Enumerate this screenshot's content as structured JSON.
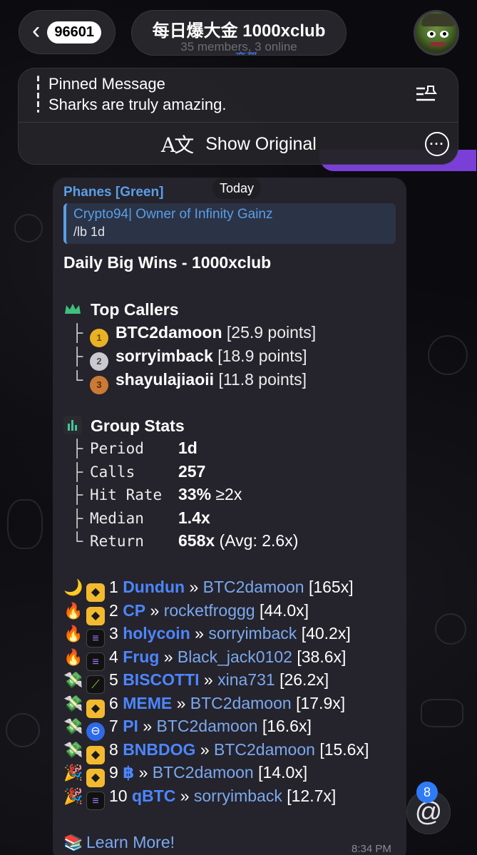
{
  "header": {
    "back_badge": "96601",
    "title": "每日爆大金 1000xclub",
    "subtitle": "35 members, 3 online",
    "typing": "••• 奕哥"
  },
  "pinned": {
    "label": "Pinned Message",
    "text": "Sharks are truly amazing.",
    "show_original": "Show Original"
  },
  "chat": {
    "date_badge": "Today",
    "sender": "Phanes [Green]",
    "reply_name": "Crypto94| Owner of Infinity Gainz",
    "reply_text": "/lb 1d",
    "headline": "Daily Big Wins - 1000xclub",
    "top_callers_title": "Top Callers",
    "top_callers": [
      {
        "tree": "├",
        "name": "BTC2damoon",
        "points": "[25.9 points]"
      },
      {
        "tree": "├",
        "name": "sorryimback",
        "points": "[18.9 points]"
      },
      {
        "tree": "└",
        "name": "shayulajiaoii",
        "points": "[11.8 points]"
      }
    ],
    "group_stats_title": "Group Stats",
    "stats": [
      {
        "tree": "├",
        "label": "Period ",
        "value": "1d",
        "extra": ""
      },
      {
        "tree": "├",
        "label": "Calls  ",
        "value": "257",
        "extra": ""
      },
      {
        "tree": "├",
        "label": "Hit Rate",
        "value": "33%",
        "extra": " ≥2x"
      },
      {
        "tree": "├",
        "label": "Median ",
        "value": "1.4x",
        "extra": ""
      },
      {
        "tree": "└",
        "label": "Return ",
        "value": "658x",
        "extra": " (Avg: 2.6x)"
      }
    ],
    "wins": [
      {
        "emoji": "🌙",
        "chain": "bnb",
        "rank": "1",
        "token": "Dundun",
        "caller": "BTC2damoon",
        "mult": "[165x]"
      },
      {
        "emoji": "🔥",
        "chain": "bnb",
        "rank": "2",
        "token": "CP",
        "caller": "rocketfroggg",
        "mult": "[44.0x]"
      },
      {
        "emoji": "🔥",
        "chain": "sol",
        "rank": "3",
        "token": "holycoin",
        "caller": "sorryimback",
        "mult": "[40.2x]"
      },
      {
        "emoji": "🔥",
        "chain": "sol",
        "rank": "4",
        "token": "Frug",
        "caller": "Black_jack0102",
        "mult": "[38.6x]"
      },
      {
        "emoji": "💸",
        "chain": "leaf",
        "rank": "5",
        "token": "BISCOTTI",
        "caller": "xina731",
        "mult": "[26.2x]"
      },
      {
        "emoji": "💸",
        "chain": "bnb",
        "rank": "6",
        "token": "MEME",
        "caller": "BTC2damoon",
        "mult": "[17.9x]"
      },
      {
        "emoji": "💸",
        "chain": "pi",
        "rank": "7",
        "token": "PI",
        "caller": "BTC2damoon",
        "mult": "[16.6x]"
      },
      {
        "emoji": "💸",
        "chain": "bnb",
        "rank": "8",
        "token": "BNBDOG",
        "caller": "BTC2damoon",
        "mult": "[15.6x]"
      },
      {
        "emoji": "🎉",
        "chain": "bnb",
        "rank": "9",
        "token": "฿",
        "caller": "BTC2damoon",
        "mult": "[14.0x]"
      },
      {
        "emoji": "🎉",
        "chain": "sol",
        "rank": "10",
        "token": "qBTC",
        "caller": "sorryimback",
        "mult": "[12.7x]"
      }
    ],
    "separator": "»",
    "learn_more": "Learn More!",
    "time": "8:34 PM"
  },
  "mentions": {
    "count": "8",
    "icon": "@"
  },
  "colors": {
    "accent_blue": "#4c86ff",
    "reply_blue": "#5a9ee8",
    "mention_badge": "#2f7bf6",
    "bubble": "#26242c"
  }
}
